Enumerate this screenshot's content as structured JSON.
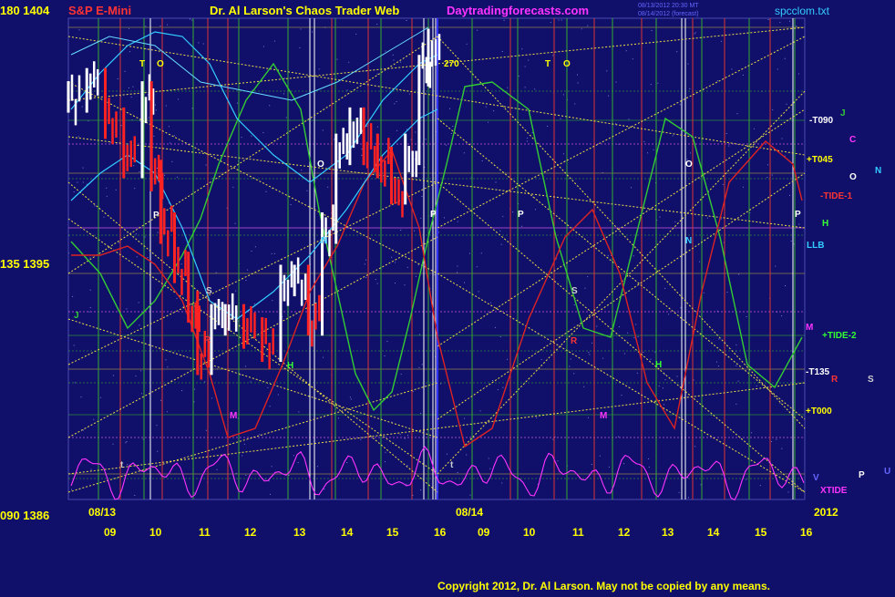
{
  "header": {
    "symbol": "S&P E-Mini",
    "title": "Dr. Al Larson's Chaos Trader Web",
    "site": "Daytradingforecasts.com",
    "file": "spcclom.txt",
    "timestamp_1": "08/13/2012 20:30 MT",
    "timestamp_2": "08/14/2012 (forecast)"
  },
  "price_scale": [
    {
      "label": "180  1404"
    },
    {
      "label": "135  1395"
    },
    {
      "label": "090  1386"
    }
  ],
  "footer": {
    "day1": "08/13",
    "day2": "08/14",
    "year": "2012",
    "copyright": "Copyright 2012, Dr. Al Larson. May not be copied by any means."
  },
  "right_labels": [
    {
      "text": "-T090",
      "color": "#ffffff"
    },
    {
      "text": "J",
      "color": "#33cc33"
    },
    {
      "text": "C",
      "color": "#ff33ff"
    },
    {
      "text": "+T045",
      "color": "#ffff00"
    },
    {
      "text": "O",
      "color": "#ffffff"
    },
    {
      "text": "N",
      "color": "#33ccff"
    },
    {
      "text": "-TIDE-1",
      "color": "#ff3333"
    },
    {
      "text": "H",
      "color": "#33ff33"
    },
    {
      "text": "LLB",
      "color": "#33ccff"
    },
    {
      "text": "M",
      "color": "#ff33ff"
    },
    {
      "text": "+TIDE-2",
      "color": "#33ff33"
    },
    {
      "text": "-T135",
      "color": "#ffffff"
    },
    {
      "text": "R",
      "color": "#ff3333"
    },
    {
      "text": "S",
      "color": "#cccccc"
    },
    {
      "text": "+T000",
      "color": "#ffff00"
    },
    {
      "text": "V",
      "color": "#6666ff"
    },
    {
      "text": "P",
      "color": "#ffffff"
    },
    {
      "text": "U",
      "color": "#6666ff"
    },
    {
      "text": "XTIDE",
      "color": "#ff33ff"
    }
  ],
  "line_labels": [
    "T",
    "O",
    "P",
    "S",
    "N",
    "R",
    "H",
    "M",
    "J",
    "270",
    "t"
  ],
  "chart_data": {
    "type": "line",
    "title": "S&P E-Mini",
    "x_tick_labels": [
      "09",
      "10",
      "11",
      "12",
      "13",
      "14",
      "15",
      "16",
      "09",
      "10",
      "11",
      "12",
      "13",
      "14",
      "15",
      "16"
    ],
    "ylim": [
      1386,
      1404
    ],
    "y_ticks": [
      1386,
      1395,
      1404
    ],
    "y_angle_ticks": [
      "090",
      "135",
      "180"
    ],
    "series": [
      {
        "name": "S&P E-Mini 08/13",
        "x_hours": [
          8.2,
          8.6,
          9.0,
          9.4,
          9.8,
          10.0,
          10.2,
          10.5,
          10.8,
          11.0,
          11.3,
          11.6,
          12.0,
          12.4,
          12.8,
          13.1,
          13.4,
          13.7,
          14.0,
          14.3,
          14.6,
          14.9,
          15.2,
          15.5,
          15.8,
          16.0
        ],
        "values": [
          1401,
          1401.5,
          1400,
          1398.5,
          1401,
          1398,
          1396,
          1394.5,
          1393,
          1391,
          1392.5,
          1392.5,
          1392,
          1391.5,
          1394,
          1394,
          1392.5,
          1396,
          1399,
          1400,
          1399,
          1398.5,
          1397.5,
          1399,
          1402,
          1403
        ]
      }
    ]
  },
  "colors": {
    "background": "#10106b",
    "grid_green": "#33aa33",
    "grid_red": "#dd3333",
    "yellow": "#ffff00",
    "white": "#ffffff",
    "cyan": "#33ccff",
    "magenta": "#ff33ff",
    "green_curve": "#33cc33",
    "red_curve": "#dd2222"
  }
}
